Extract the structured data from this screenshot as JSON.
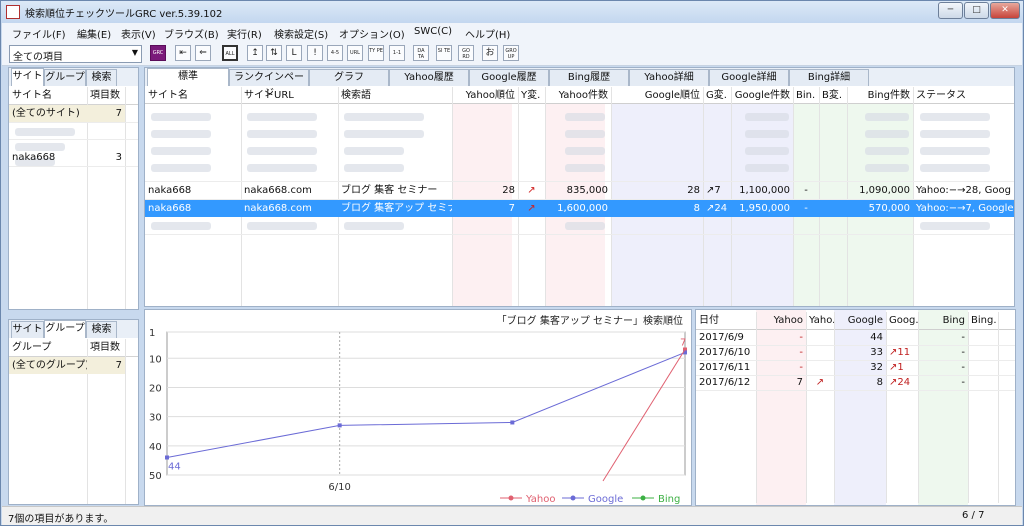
{
  "window": {
    "title": "検索順位チェックツールGRC ver.5.39.102",
    "controls": [
      "─",
      "□",
      "✕"
    ]
  },
  "menu": [
    "ファイル(F)",
    "編集(E)",
    "表示(V)",
    "ブラウズ(B)",
    "実行(R)",
    "検索設定(S)",
    "オプション(O)",
    "SWC(C)",
    "ヘルプ(H)"
  ],
  "toolbar": {
    "filter_value": "全ての項目",
    "buttons": [
      "GRC",
      "⇤",
      "⇐",
      "ALL",
      "↥",
      "⇅",
      "L",
      "!",
      "4-5",
      "URL",
      "TY PE",
      "1-1",
      "DA TA",
      "SI TE",
      "GO RD",
      "お",
      "GRO UP"
    ]
  },
  "left_top": {
    "tabs": [
      "サイト",
      "グループ",
      "検索"
    ],
    "headers": [
      "サイト名",
      "項目数"
    ],
    "rows": [
      [
        "(全てのサイト)",
        "7"
      ],
      [
        "naka668",
        "3"
      ]
    ]
  },
  "left_bottom": {
    "tabs": [
      "サイト",
      "グループ",
      "検索"
    ],
    "headers": [
      "グループ",
      "項目数"
    ],
    "rows": [
      [
        "(全てのグループ)",
        "7"
      ]
    ]
  },
  "main_tabs": [
    "標準",
    "ランクインページ",
    "グラフ",
    "Yahoo履歴",
    "Google履歴",
    "Bing履歴",
    "Yahoo詳細",
    "Google詳細",
    "Bing詳細"
  ],
  "main_table": {
    "headers": [
      "サイト名",
      "サイトURL",
      "検索語",
      "Yahoo順位",
      "Y変.",
      "Yahoo件数",
      "Google順位",
      "G変.",
      "Google件数",
      "Bin.",
      "B変.",
      "Bing件数",
      "ステータス"
    ],
    "rows": [
      [
        "naka668",
        "naka668.com",
        "ブログ 集客 セミナー",
        "28",
        "↗",
        "835,000",
        "28",
        "↗7",
        "1,100,000",
        "-",
        "",
        "1,090,000",
        "Yahoo:−→28, Goog"
      ],
      [
        "naka668",
        "naka668.com",
        "ブログ 集客アップ セミナー",
        "7",
        "↗",
        "1,600,000",
        "8",
        "↗24",
        "1,950,000",
        "-",
        "",
        "570,000",
        "Yahoo:−→7, Google"
      ]
    ]
  },
  "chart_data": {
    "type": "line",
    "title": "「ブログ 集客アップ セミナー」検索順位",
    "x": [
      "2017/6/9",
      "2017/6/10",
      "2017/6/11",
      "2017/6/12"
    ],
    "xticks": [
      "6/10"
    ],
    "y_ticks": [
      "1",
      "10",
      "20",
      "30",
      "40",
      "50"
    ],
    "ylim": [
      1,
      50
    ],
    "y_inverted": true,
    "series": [
      {
        "name": "Yahoo",
        "color": "#e06070",
        "values": [
          null,
          null,
          null,
          7
        ]
      },
      {
        "name": "Google",
        "color": "#6b6bd6",
        "values": [
          44,
          33,
          32,
          8
        ]
      },
      {
        "name": "Bing",
        "color": "#3cb043",
        "values": [
          null,
          null,
          null,
          null
        ]
      }
    ],
    "point_labels": {
      "first": "44",
      "last": "7"
    }
  },
  "history": {
    "headers": [
      "日付",
      "Yahoo",
      "Yaho.",
      "Google",
      "Goog.",
      "Bing",
      "Bing."
    ],
    "rows": [
      [
        "2017/6/9",
        "-",
        "",
        "44",
        "",
        "-",
        ""
      ],
      [
        "2017/6/10",
        "-",
        "",
        "33",
        "↗11",
        "-",
        ""
      ],
      [
        "2017/6/11",
        "-",
        "",
        "32",
        "↗1",
        "-",
        ""
      ],
      [
        "2017/6/12",
        "7",
        "↗",
        "8",
        "↗24",
        "-",
        ""
      ]
    ]
  },
  "status": {
    "message": "7個の項目があります。",
    "page": "6 / 7"
  }
}
